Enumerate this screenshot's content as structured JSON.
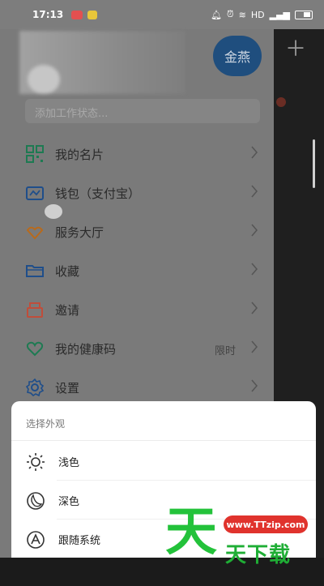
{
  "status_bar": {
    "time": "17:13",
    "network": "HD"
  },
  "drawer": {
    "avatar_text": "金燕",
    "status_placeholder": "添加工作状态...",
    "menu": [
      {
        "label": "我的名片",
        "icon": "qrcode-icon",
        "tag": ""
      },
      {
        "label": "钱包（支付宝）",
        "icon": "wallet-icon",
        "tag": ""
      },
      {
        "label": "服务大厅",
        "icon": "handshake-icon",
        "tag": ""
      },
      {
        "label": "收藏",
        "icon": "folder-icon",
        "tag": ""
      },
      {
        "label": "邀请",
        "icon": "invite-icon",
        "tag": ""
      },
      {
        "label": "我的健康码",
        "icon": "heart-icon",
        "tag": "限时"
      },
      {
        "label": "设置",
        "icon": "gear-icon",
        "tag": ""
      }
    ]
  },
  "sheet": {
    "title": "选择外观",
    "options": [
      {
        "label": "浅色",
        "icon": "sun-icon"
      },
      {
        "label": "深色",
        "icon": "moon-icon"
      },
      {
        "label": "跟随系统",
        "icon": "auto-icon"
      }
    ]
  },
  "watermark": {
    "big_char": "天",
    "url": "www.TTzip.com",
    "text": "天下载"
  },
  "colors": {
    "dim_overlay": "#7a7a7a",
    "icon_green": "#1e7a52",
    "icon_blue": "#1f4e8a",
    "icon_orange": "#b86a1c",
    "icon_red": "#c04d3a",
    "watermark_green": "#23c23a",
    "watermark_red": "#e0332d"
  }
}
